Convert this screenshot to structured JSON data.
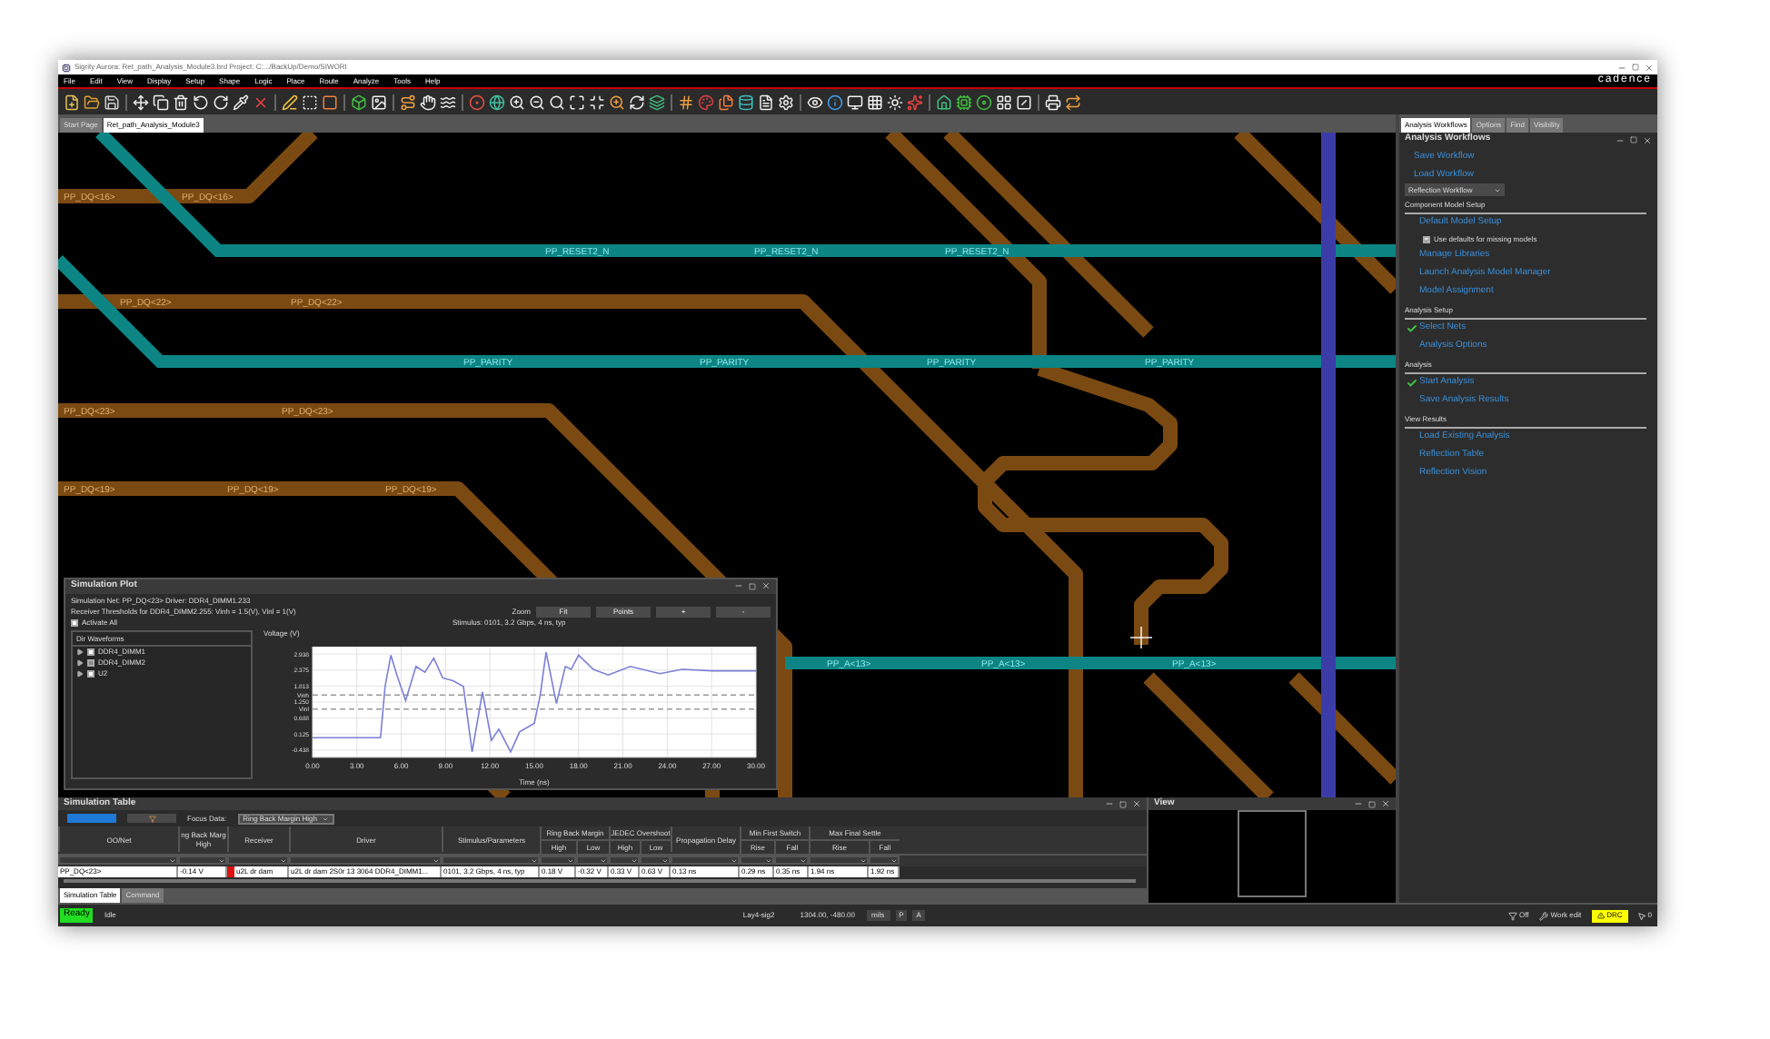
{
  "window": {
    "title": "Sigrity Aurora: Ret_path_Analysis_Module3.brd  Project: C:.../BackUp/Demo/SIWORI"
  },
  "menu": [
    "File",
    "Edit",
    "View",
    "Display",
    "Setup",
    "Shape",
    "Logic",
    "Place",
    "Route",
    "Analyze",
    "Tools",
    "Help"
  ],
  "logo": "cadence",
  "doc_tabs": [
    {
      "label": "Start Page",
      "selected": false
    },
    {
      "label": "Ret_path_Analysis_Module3",
      "selected": true
    }
  ],
  "canvas": {
    "net_labels": [
      "PP_DQ<16>",
      "PP_DQ<16>",
      "PP_RESET2_N",
      "PP_RESET2_N",
      "PP_RESET2_N",
      "PP_DQ<22>",
      "PP_DQ<22>",
      "PP_PARITY",
      "PP_PARITY",
      "PP_PARITY",
      "PP_PARITY",
      "PP_DQ<23>",
      "PP_DQ<23>",
      "PP_DQ<19>",
      "PP_DQ<19>",
      "PP_DQ<19>",
      "PP_A<13>",
      "PP_A<13>",
      "PP_A<13>"
    ]
  },
  "simulation_plot": {
    "title": "Simulation Plot",
    "info": [
      "Simulation Net: PP_DQ<23>  Driver: DDR4_DIMM1.233",
      "Receiver Thresholds for DDR4_DIMM2.255: Vinh = 1.5(V), Vinl = 1(V)"
    ],
    "activate_all": {
      "label": "Activate All",
      "checked": false
    },
    "zoom_label": "Zoom",
    "zoom_buttons": [
      "Fit",
      "Points",
      "+",
      "-"
    ],
    "stimulus": "Stimulus: 0101, 3.2 Gbps, 4 ns, typ",
    "waveforms": {
      "title": "Dir Waveforms",
      "items": [
        {
          "label": "DDR4_DIMM1",
          "checked": false
        },
        {
          "label": "DDR4_DIMM2",
          "checked": true
        },
        {
          "label": "U2",
          "checked": false
        }
      ]
    },
    "chart_data": {
      "type": "line",
      "xlabel": "Time (ns)",
      "ylabel": "Voltage (V)",
      "grid": true,
      "x": [
        0,
        4.6,
        4.9,
        5.3,
        5.7,
        6.3,
        7.0,
        7.6,
        8.2,
        8.8,
        9.5,
        10.2,
        10.8,
        11.5,
        12.1,
        12.6,
        13.4,
        14.0,
        15.0,
        15.4,
        15.8,
        16.5,
        17.1,
        17.5,
        18.0,
        19.0,
        20.0,
        21.5,
        23.5,
        25.0,
        27.0,
        30.0
      ],
      "series": [
        {
          "color": "#7b7fd6",
          "values": [
            0.0,
            0.0,
            1.8,
            2.9,
            2.2,
            1.3,
            2.5,
            2.3,
            2.8,
            2.1,
            2.0,
            1.8,
            -0.5,
            1.6,
            -0.1,
            0.3,
            -0.5,
            0.2,
            0.5,
            1.5,
            3.0,
            1.2,
            2.5,
            2.4,
            2.9,
            2.4,
            2.2,
            2.5,
            2.25,
            2.4,
            2.35,
            2.35
          ]
        }
      ],
      "xlim": [
        0,
        30
      ],
      "ylim": [
        -0.7,
        3.2
      ],
      "xticks": [
        {
          "value": 0,
          "label": "0.00"
        },
        {
          "value": 3,
          "label": "3.00"
        },
        {
          "value": 6,
          "label": "6.00"
        },
        {
          "value": 9,
          "label": "9.00"
        },
        {
          "value": 12,
          "label": "12.00"
        },
        {
          "value": 15,
          "label": "15.00"
        },
        {
          "value": 18,
          "label": "18.00"
        },
        {
          "value": 21,
          "label": "21.00"
        },
        {
          "value": 24,
          "label": "24.00"
        },
        {
          "value": 27,
          "label": "27.00"
        },
        {
          "value": 30,
          "label": "30.00"
        }
      ],
      "yticks": [
        {
          "value": 2.938,
          "label": "2.938"
        },
        {
          "value": 2.375,
          "label": "2.375"
        },
        {
          "value": 1.813,
          "label": "1.813"
        },
        {
          "value": 1.25,
          "label": "1.250"
        },
        {
          "value": 0.688,
          "label": "0.688"
        },
        {
          "value": 0.125,
          "label": "0.125"
        },
        {
          "value": -0.438,
          "label": "-0.438"
        }
      ],
      "ref_lines": [
        {
          "axis": "y",
          "value": 1.5,
          "label": "Vinh"
        },
        {
          "axis": "y",
          "value": 1.0,
          "label": "Vinl"
        }
      ]
    }
  },
  "simulation_table": {
    "title": "Simulation Table",
    "focus_label": "Focus Data:",
    "focus_value": "Ring Back Margin High",
    "column_groups": [
      "Ring Back Margin",
      "JEDEC Overshoot",
      "Min First Switch",
      "Max Final Settle"
    ],
    "columns": [
      "OO/Net",
      "ng Back Marg High",
      "Receiver",
      "Driver",
      "Stimulus/Parameters",
      "High",
      "Low",
      "High",
      "Low",
      "Propagation Delay",
      "Rise",
      "Fall",
      "Rise",
      "Fall"
    ],
    "rows": [
      {
        "color": "#e01010",
        "cells": [
          "PP_DQ<23>",
          "-0.14 V",
          "u2L dr dam",
          "u2L dr dam 2S0r 13 3064 DDR4_DIMM1...",
          "0101, 3.2 Gbps, 4 ns, typ",
          "0.18 V",
          "-0.32 V",
          "0.33 V",
          "0.63 V",
          "0.13 ns",
          "0.29 ns",
          "0.35 ns",
          "1.94 ns",
          "1.92 ns"
        ]
      }
    ]
  },
  "bottom_tabs": [
    {
      "label": "Simulation Table",
      "selected": true
    },
    {
      "label": "Command",
      "selected": false
    }
  ],
  "view_panel": {
    "title": "View"
  },
  "right_panel": {
    "tabs": [
      {
        "label": "Analysis Workflows",
        "selected": true
      },
      {
        "label": "Options",
        "selected": false
      },
      {
        "label": "Find",
        "selected": false
      },
      {
        "label": "Visibility",
        "selected": false
      }
    ],
    "title": "Analysis Workflows",
    "links": [
      "Save Workflow",
      "Load Workflow"
    ],
    "workflow_select": "Reflection Workflow",
    "sections": [
      {
        "title": "Component Model Setup",
        "items": [
          {
            "kind": "link",
            "label": "Default Model Setup",
            "done": false
          },
          {
            "kind": "checkbox",
            "label": "Use defaults for missing models",
            "checked": true
          },
          {
            "kind": "link",
            "label": "Manage Libraries",
            "done": false
          },
          {
            "kind": "link",
            "label": "Launch Analysis Model Manager",
            "done": false
          },
          {
            "kind": "link",
            "label": "Model Assignment",
            "done": false
          }
        ]
      },
      {
        "title": "Analysis Setup",
        "items": [
          {
            "kind": "link",
            "label": "Select Nets",
            "done": true
          },
          {
            "kind": "link",
            "label": "Analysis Options",
            "done": false
          }
        ]
      },
      {
        "title": "Analysis",
        "items": [
          {
            "kind": "link",
            "label": "Start Analysis",
            "done": true
          },
          {
            "kind": "link",
            "label": "Save Analysis Results",
            "done": false
          }
        ]
      },
      {
        "title": "View Results",
        "items": [
          {
            "kind": "link",
            "label": "Load Existing Analysis",
            "done": false
          },
          {
            "kind": "link",
            "label": "Reflection Table",
            "done": false
          },
          {
            "kind": "link",
            "label": "Reflection Vision",
            "done": false
          }
        ]
      }
    ]
  },
  "status_bar": {
    "state": "Ready",
    "activity": "Idle",
    "layer": "Lay4-sig2",
    "coords": "1304.00, -480.00",
    "units": "mils",
    "buttons": [
      "P",
      "A"
    ],
    "filter": "Off",
    "mode": "Work edit",
    "drc": "DRC",
    "count": "0"
  }
}
